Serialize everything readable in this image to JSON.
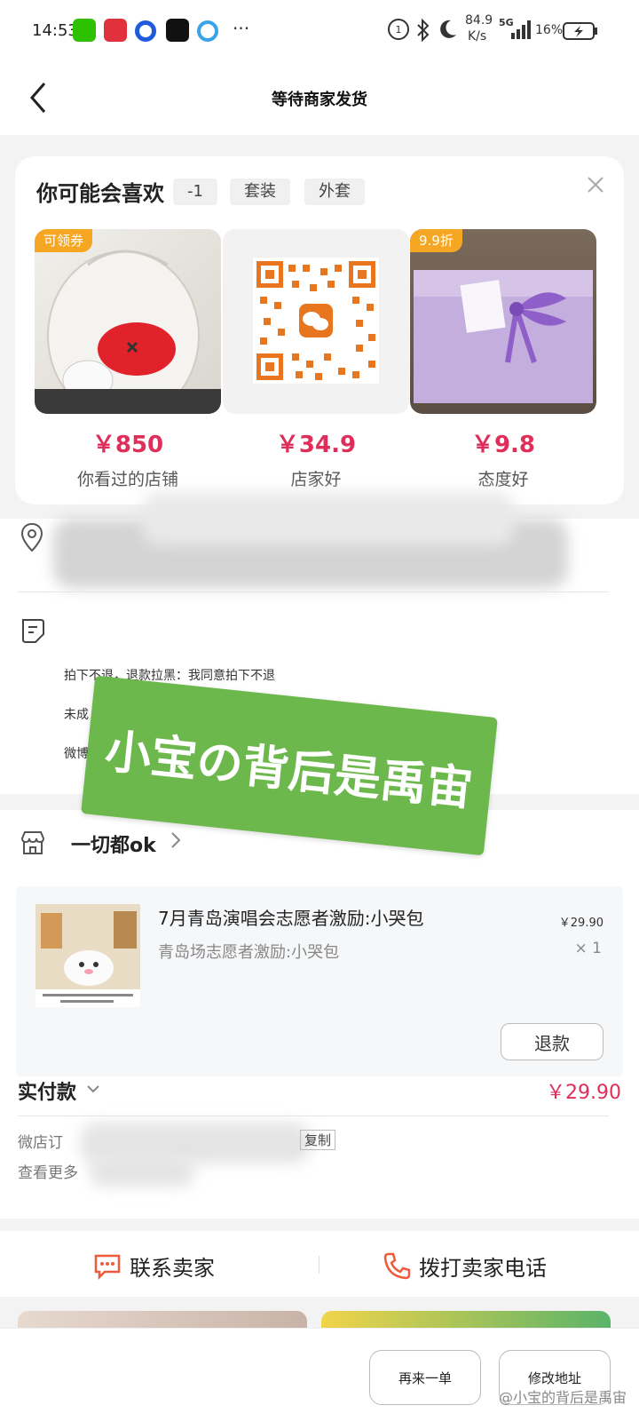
{
  "status_bar": {
    "time": "14:53",
    "speed_value": "84.9",
    "speed_unit": "K/s",
    "network": "5G",
    "battery": "16%",
    "more_dots": "···"
  },
  "nav": {
    "title": "等待商家发货"
  },
  "recommend": {
    "title": "你可能会喜欢",
    "tags": [
      "-1",
      "套装",
      "外套"
    ],
    "products": [
      {
        "badge": "可领券",
        "price": "￥850",
        "name": "你看过的店铺"
      },
      {
        "badge": "",
        "price": "￥34.9",
        "name": "店家好"
      },
      {
        "badge": "9.9折",
        "price": "￥9.8",
        "name": "态度好"
      }
    ]
  },
  "address": {
    "note_lines": [
      "拍下不退，退款拉黑：我同意拍下不退",
      "未成",
      "微博"
    ]
  },
  "sticker": {
    "text": "小宝の背后是禹宙"
  },
  "order": {
    "shop_name": "一切都ok",
    "item": {
      "title": "7月青岛演唱会志愿者激励:小哭包",
      "subtitle": "青岛场志愿者激励:小哭包",
      "price": "￥29.90",
      "qty": "× 1"
    },
    "refund_label": "退款",
    "paid_label": "实付款",
    "paid_amount": "￥29.90",
    "order_no_label": "微店订",
    "copy_label": "复制",
    "more_info_label": "查看更多"
  },
  "contact": {
    "seller_label": "联系卖家",
    "phone_label": "拨打卖家电话"
  },
  "bottom": {
    "reorder_label": "再来一单",
    "change_addr_label": "修改地址",
    "watermark": "@小宝的背后是禹宙"
  },
  "colors": {
    "accent_price": "#e02e5a",
    "badge_orange": "#f5a623",
    "sticker_green": "#6cb84d",
    "icon_orange_red": "#f05a3c"
  }
}
